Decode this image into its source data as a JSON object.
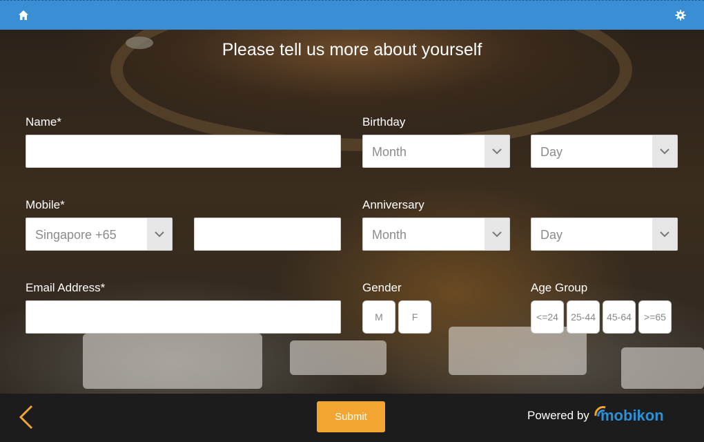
{
  "title": "Please tell us more about yourself",
  "colors": {
    "topbar": "#3a8fd4",
    "accent": "#f3a531",
    "brand": "#2d8fd6"
  },
  "icons": {
    "home": "home-icon",
    "settings": "gear-icon",
    "back": "chevron-left-icon",
    "dropdown": "chevron-down-icon"
  },
  "form": {
    "name": {
      "label": "Name*",
      "value": ""
    },
    "mobile": {
      "label": "Mobile*",
      "country_code": "Singapore +65",
      "value": ""
    },
    "email": {
      "label": "Email Address*",
      "value": ""
    },
    "birthday": {
      "label": "Birthday",
      "month": "Month",
      "day": "Day"
    },
    "anniversary": {
      "label": "Anniversary",
      "month": "Month",
      "day": "Day"
    },
    "gender": {
      "label": "Gender",
      "options": [
        "M",
        "F"
      ]
    },
    "age_group": {
      "label": "Age Group",
      "options": [
        "<=24",
        "25-44",
        "45-64",
        ">=65"
      ]
    }
  },
  "footer": {
    "submit_label": "Submit",
    "powered_by": "Powered by",
    "brand": "mobikon"
  }
}
